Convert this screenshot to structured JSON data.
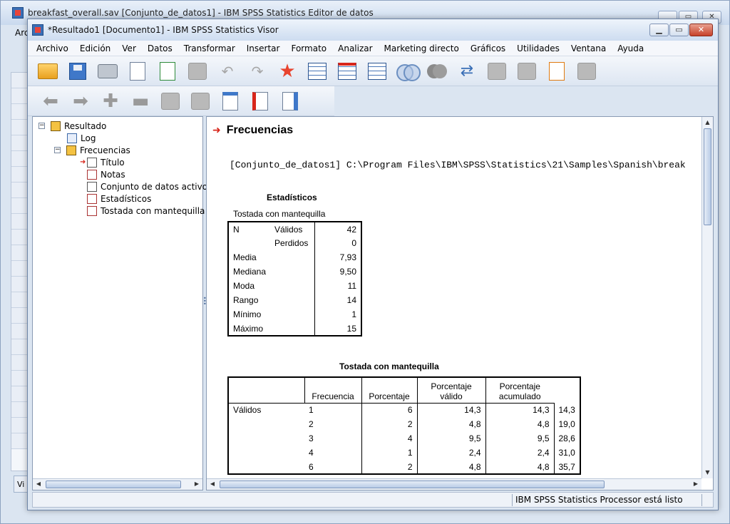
{
  "background_window": {
    "title": "breakfast_overall.sav [Conjunto_de_datos1] - IBM SPSS Statistics Editor de datos",
    "menu_fragment": "Arc",
    "tab_fragment": "Vi"
  },
  "window": {
    "title": "*Resultado1 [Documento1] - IBM SPSS Statistics Visor"
  },
  "menu": [
    "Archivo",
    "Edición",
    "Ver",
    "Datos",
    "Transformar",
    "Insertar",
    "Formato",
    "Analizar",
    "Marketing directo",
    "Gráficos",
    "Utilidades",
    "Ventana",
    "Ayuda"
  ],
  "tree": {
    "root": "Resultado",
    "log": "Log",
    "group": "Frecuencias",
    "children": [
      "Título",
      "Notas",
      "Conjunto de datos activo",
      "Estadísticos",
      "Tostada con mantequilla"
    ]
  },
  "output": {
    "heading": "Frecuencias",
    "syntax": "[Conjunto_de_datos1] C:\\Program Files\\IBM\\SPSS\\Statistics\\21\\Samples\\Spanish\\break",
    "stats_title": "Estadísticos",
    "stats_subtitle": "Tostada con mantequilla",
    "stats_rows": [
      {
        "l1": "N",
        "l2": "Válidos",
        "v": "42"
      },
      {
        "l1": "",
        "l2": "Perdidos",
        "v": "0"
      },
      {
        "l1": "Media",
        "l2": "",
        "v": "7,93"
      },
      {
        "l1": "Mediana",
        "l2": "",
        "v": "9,50"
      },
      {
        "l1": "Moda",
        "l2": "",
        "v": "11"
      },
      {
        "l1": "Rango",
        "l2": "",
        "v": "14"
      },
      {
        "l1": "Mínimo",
        "l2": "",
        "v": "1"
      },
      {
        "l1": "Máximo",
        "l2": "",
        "v": "15"
      }
    ],
    "freq_title": "Tostada con mantequilla",
    "freq_headers": [
      "Frecuencia",
      "Porcentaje",
      "Porcentaje válido",
      "Porcentaje acumulado"
    ],
    "freq_group": "Válidos",
    "freq_rows": [
      {
        "k": "1",
        "f": "6",
        "p": "14,3",
        "pv": "14,3",
        "pa": "14,3"
      },
      {
        "k": "2",
        "f": "2",
        "p": "4,8",
        "pv": "4,8",
        "pa": "19,0"
      },
      {
        "k": "3",
        "f": "4",
        "p": "9,5",
        "pv": "9,5",
        "pa": "28,6"
      },
      {
        "k": "4",
        "f": "1",
        "p": "2,4",
        "pv": "2,4",
        "pa": "31,0"
      },
      {
        "k": "6",
        "f": "2",
        "p": "4,8",
        "pv": "4,8",
        "pa": "35,7"
      }
    ]
  },
  "status": "IBM SPSS Statistics Processor está listo"
}
